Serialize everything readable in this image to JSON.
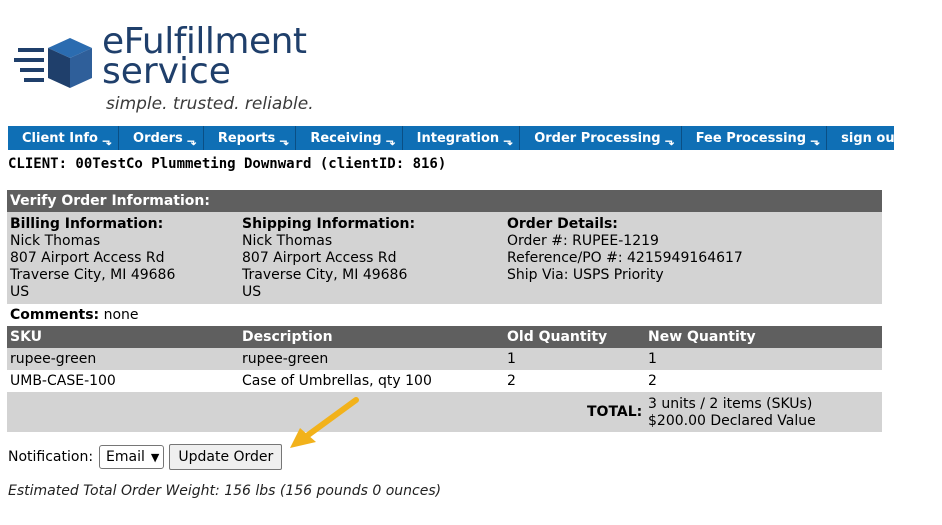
{
  "logo": {
    "title": "eFulfillment",
    "sub": "service",
    "tagline": "simple. trusted. reliable."
  },
  "nav": [
    {
      "label": "Client Info"
    },
    {
      "label": "Orders"
    },
    {
      "label": "Reports"
    },
    {
      "label": "Receiving"
    },
    {
      "label": "Integration"
    },
    {
      "label": "Order Processing"
    },
    {
      "label": "Fee Processing"
    },
    {
      "label": "sign out"
    }
  ],
  "client_line": "CLIENT: 00TestCo Plummeting Downward (clientID: 816)",
  "verify_title": "Verify Order Information:",
  "billing": {
    "title": "Billing Information:",
    "name": "Nick Thomas",
    "street": "807 Airport Access Rd",
    "city": "Traverse City, MI 49686",
    "country": "US"
  },
  "shipping": {
    "title": "Shipping Information:",
    "name": "Nick Thomas",
    "street": "807 Airport Access Rd",
    "city": "Traverse City, MI 49686",
    "country": "US"
  },
  "details": {
    "title": "Order Details:",
    "order": "Order #: RUPEE-1219",
    "ref": "Reference/PO #: 4215949164617",
    "ship": "Ship Via: USPS Priority"
  },
  "comments": {
    "label": "Comments:",
    "value": "none"
  },
  "table": {
    "headers": [
      "SKU",
      "Description",
      "Old Quantity",
      "New Quantity"
    ],
    "rows": [
      [
        "rupee-green",
        "rupee-green",
        "1",
        "1"
      ],
      [
        "UMB-CASE-100",
        "Case of Umbrellas, qty 100",
        "2",
        "2"
      ]
    ]
  },
  "total": {
    "label": "TOTAL:",
    "line1": "3 units / 2 items (SKUs)",
    "line2": "$200.00 Declared Value"
  },
  "notification": {
    "label": "Notification:",
    "selected": "Email",
    "button": "Update Order"
  },
  "weight": "Estimated Total Order Weight: 156 lbs (156 pounds 0 ounces)",
  "colors": {
    "nav": "#0f6fb5",
    "bar": "#5f5f5f",
    "row": "#d3d3d3",
    "logo": "#1f3f6b",
    "arrow": "#f2b21b"
  }
}
